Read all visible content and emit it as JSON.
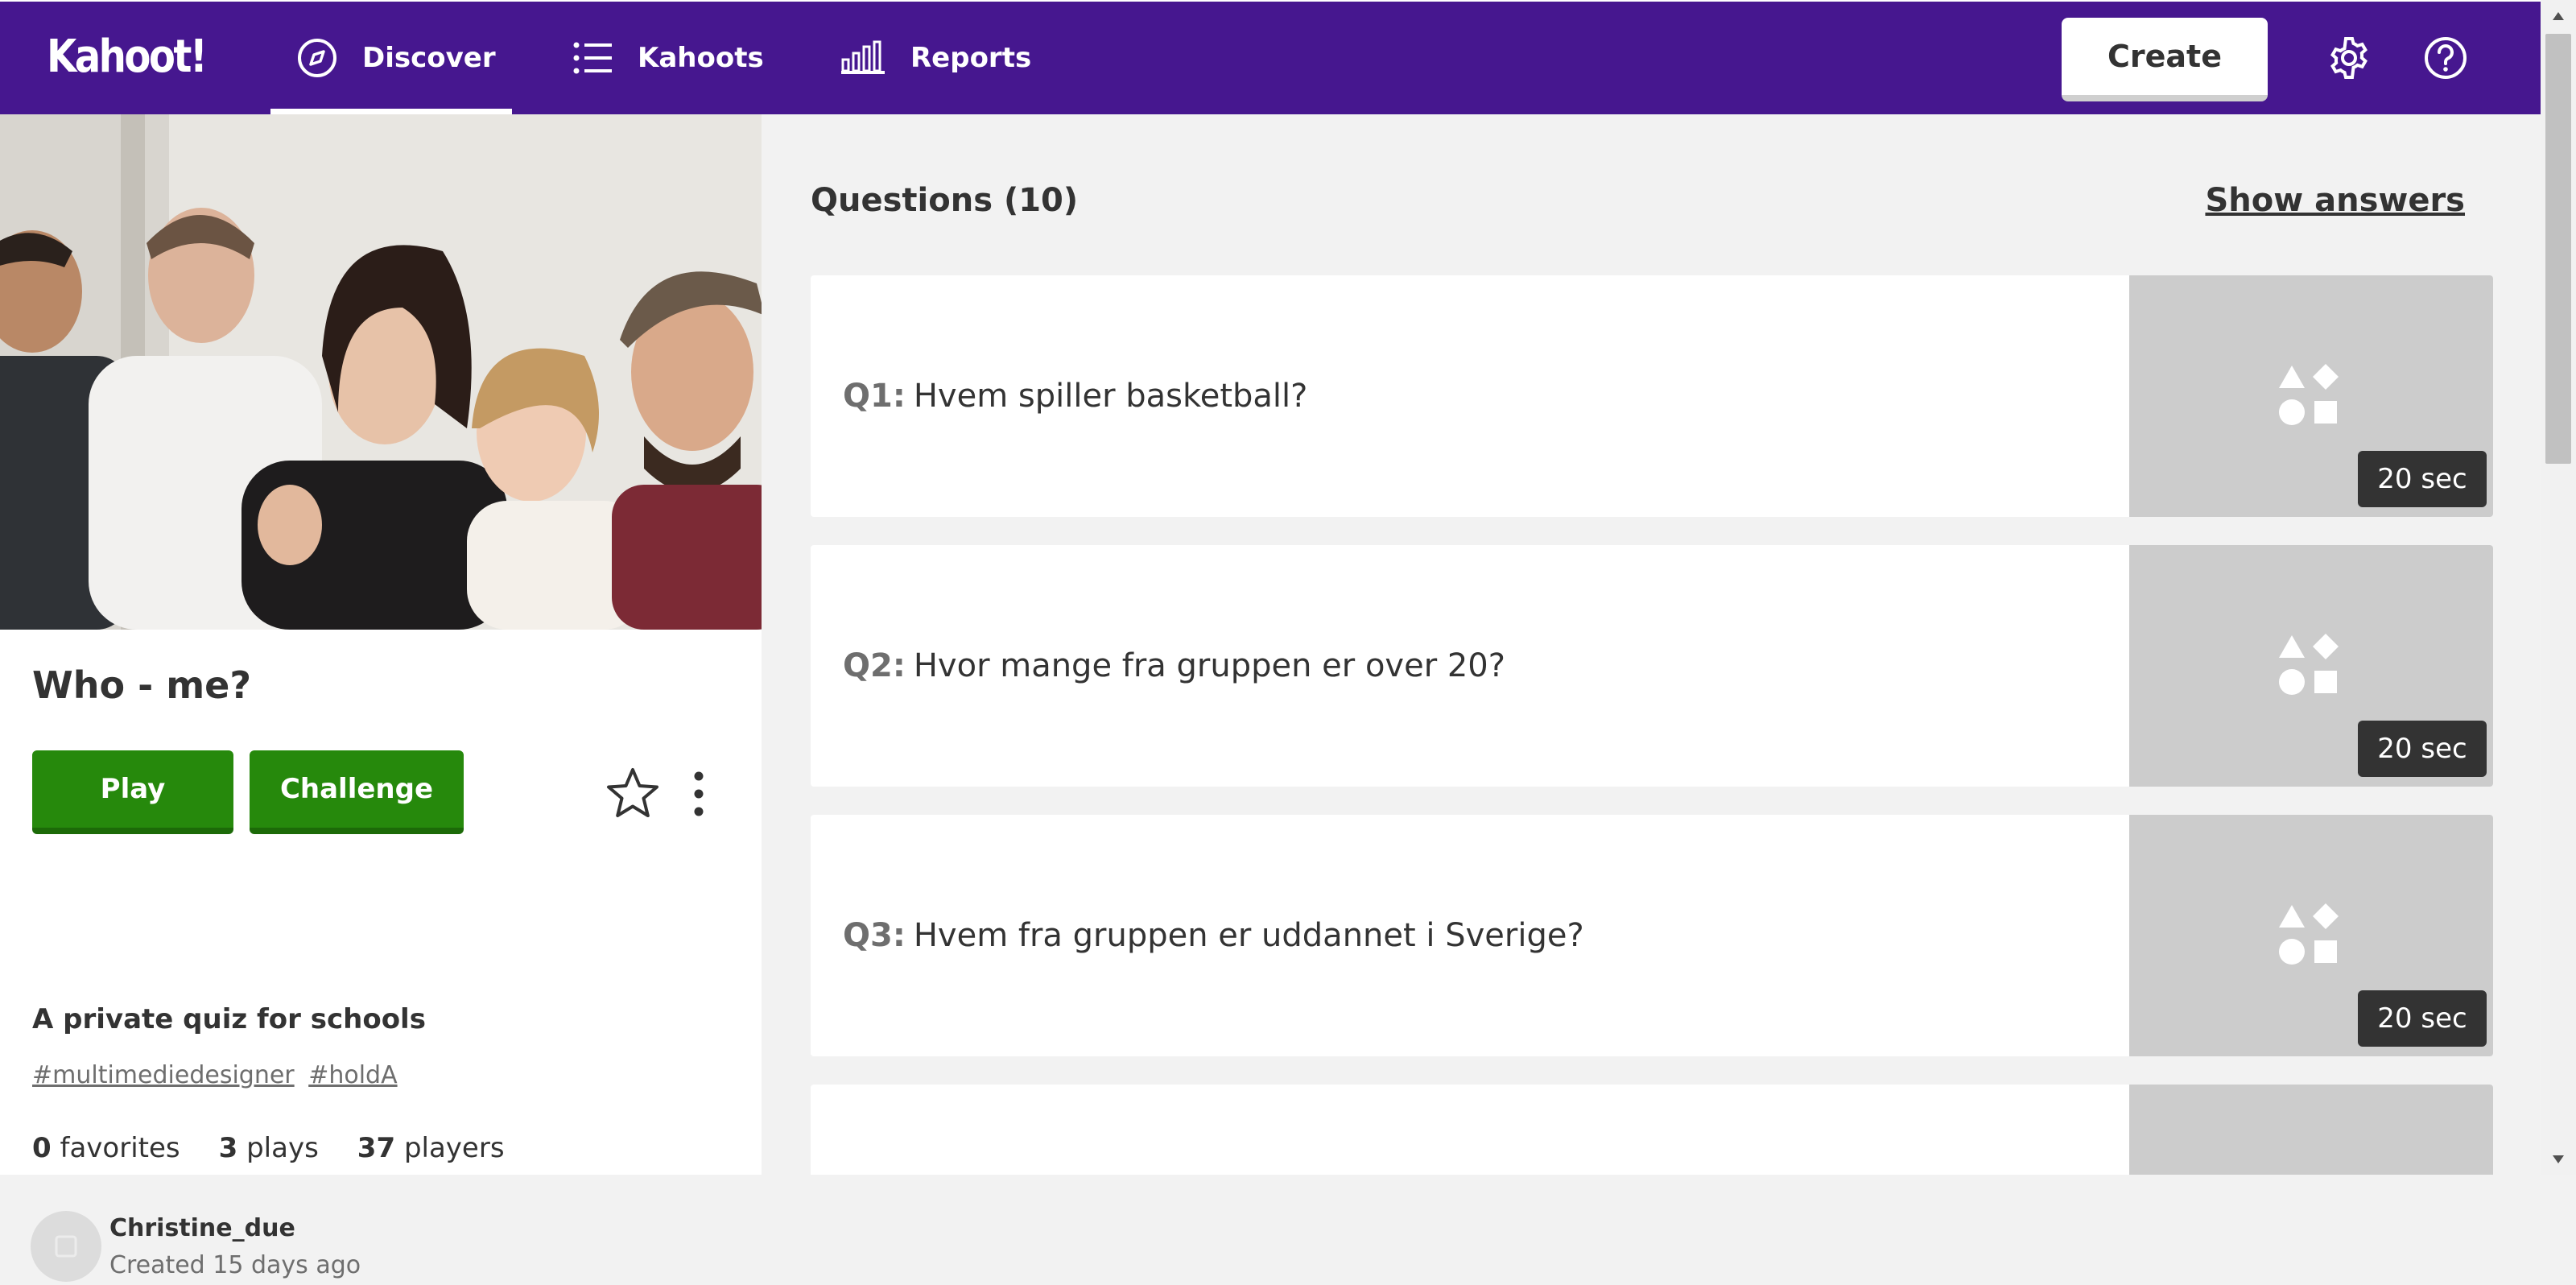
{
  "app": {
    "logo_text": "Kahoot!"
  },
  "nav": {
    "items": [
      {
        "label": "Discover",
        "icon": "compass-icon",
        "active": true
      },
      {
        "label": "Kahoots",
        "icon": "list-icon",
        "active": false
      },
      {
        "label": "Reports",
        "icon": "bar-chart-icon",
        "active": false
      }
    ],
    "create_label": "Create",
    "settings_icon": "gear-icon",
    "help_icon": "question-circle-icon"
  },
  "kahoot": {
    "title": "Who - me?",
    "play_label": "Play",
    "challenge_label": "Challenge",
    "description": "A private quiz for schools",
    "tags": [
      "#multimediedesigner",
      "#holdA"
    ],
    "stats": {
      "favorites_count": "0",
      "favorites_label": "favorites",
      "plays_count": "3",
      "plays_label": "plays",
      "players_count": "37",
      "players_label": "players"
    },
    "author": "Christine_due",
    "created": "Created 15 days ago"
  },
  "questions": {
    "heading": "Questions (10)",
    "show_answers_label": "Show answers",
    "items": [
      {
        "num": "Q1:",
        "text": "Hvem spiller basketball?",
        "time": "20 sec"
      },
      {
        "num": "Q2:",
        "text": "Hvor mange fra gruppen er over 20?",
        "time": "20 sec"
      },
      {
        "num": "Q3:",
        "text": "Hvem fra gruppen er uddannet i Sverige?",
        "time": "20 sec"
      },
      {
        "num": "",
        "text": "",
        "time": ""
      }
    ]
  },
  "colors": {
    "brand_purple": "#46178f",
    "play_green": "#26890c",
    "page_bg": "#f2f2f2",
    "thumb_gray": "#cccccc",
    "time_badge": "#333333"
  }
}
